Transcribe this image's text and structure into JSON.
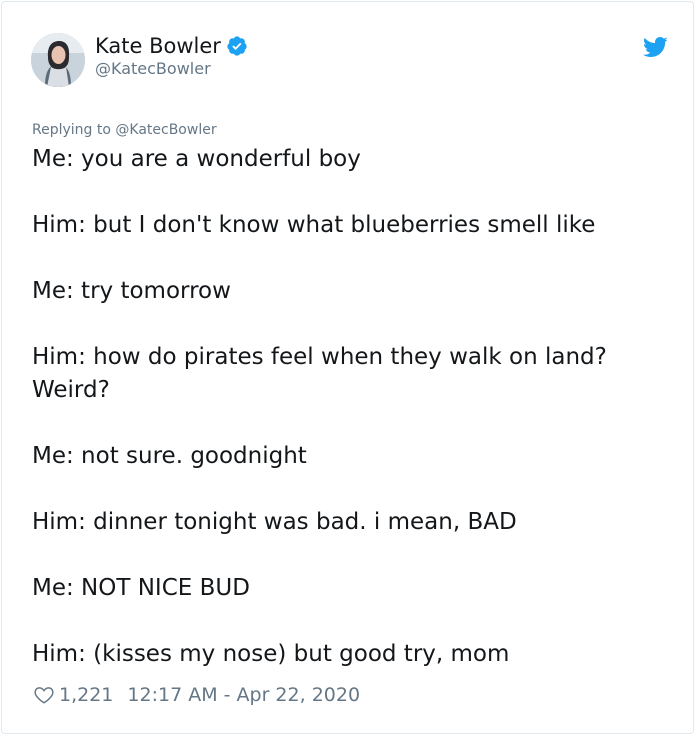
{
  "author": {
    "name": "Kate Bowler",
    "handle": "@KatecBowler",
    "verified": true
  },
  "reply": {
    "prefix": "Replying to ",
    "to": "@KatecBowler"
  },
  "tweet": {
    "lines": [
      "Me: you are a wonderful boy",
      "Him: but I don't know what blueberries smell like",
      "Me: try tomorrow",
      "Him: how do pirates feel when they walk on land? Weird?",
      "Me: not sure. goodnight",
      "Him: dinner tonight was bad. i mean, BAD",
      "Me: NOT NICE BUD",
      "Him: (kisses my nose) but good try, mom"
    ]
  },
  "footer": {
    "likes": "1,221",
    "timestamp": "12:17 AM - Apr 22, 2020"
  },
  "icons": {
    "twitter": "twitter-bird-icon",
    "verified": "verified-badge-icon",
    "like": "heart-icon"
  },
  "colors": {
    "brand_blue": "#1da1f2",
    "text": "#14171a",
    "secondary": "#657786"
  }
}
